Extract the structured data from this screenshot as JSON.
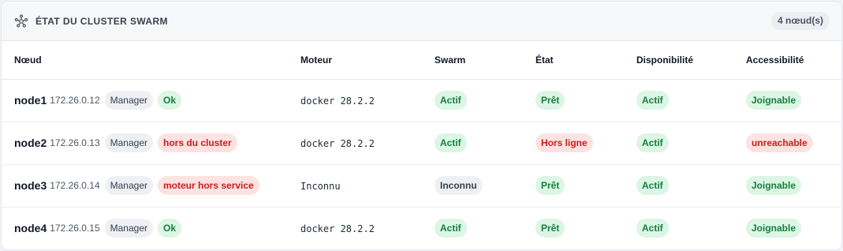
{
  "header": {
    "title": "ÉTAT DU CLUSTER SWARM",
    "icon": "cluster-icon",
    "count": "4 nœud(s)"
  },
  "columns": [
    "Nœud",
    "Moteur",
    "Swarm",
    "État",
    "Disponibilité",
    "Accessibilité"
  ],
  "nodes": [
    {
      "name": "node1",
      "ip": "172.26.0.12",
      "role": "Manager",
      "status": {
        "label": "Ok",
        "tone": "green"
      },
      "engine": "docker 28.2.2",
      "swarm": {
        "label": "Actif",
        "tone": "green"
      },
      "state": {
        "label": "Prêt",
        "tone": "green"
      },
      "availability": {
        "label": "Actif",
        "tone": "green"
      },
      "reachability": {
        "label": "Joignable",
        "tone": "green"
      }
    },
    {
      "name": "node2",
      "ip": "172.26.0.13",
      "role": "Manager",
      "status": {
        "label": "hors du cluster",
        "tone": "red"
      },
      "engine": "docker 28.2.2",
      "swarm": {
        "label": "Actif",
        "tone": "green"
      },
      "state": {
        "label": "Hors ligne",
        "tone": "red"
      },
      "availability": {
        "label": "Actif",
        "tone": "green"
      },
      "reachability": {
        "label": "unreachable",
        "tone": "red"
      }
    },
    {
      "name": "node3",
      "ip": "172.26.0.14",
      "role": "Manager",
      "status": {
        "label": "moteur hors service",
        "tone": "red"
      },
      "engine": "Inconnu",
      "swarm": {
        "label": "Inconnu",
        "tone": "gray-b"
      },
      "state": {
        "label": "Prêt",
        "tone": "green"
      },
      "availability": {
        "label": "Actif",
        "tone": "green"
      },
      "reachability": {
        "label": "Joignable",
        "tone": "green"
      }
    },
    {
      "name": "node4",
      "ip": "172.26.0.15",
      "role": "Manager",
      "status": {
        "label": "Ok",
        "tone": "green"
      },
      "engine": "docker 28.2.2",
      "swarm": {
        "label": "Actif",
        "tone": "green"
      },
      "state": {
        "label": "Prêt",
        "tone": "green"
      },
      "availability": {
        "label": "Actif",
        "tone": "green"
      },
      "reachability": {
        "label": "Joignable",
        "tone": "green"
      }
    }
  ],
  "colors": {
    "green_bg": "#dcf5e4",
    "green_text": "#15803d",
    "red_bg": "#fde2e2",
    "red_text": "#c81e1e",
    "gray_bg": "#eef0f4"
  }
}
